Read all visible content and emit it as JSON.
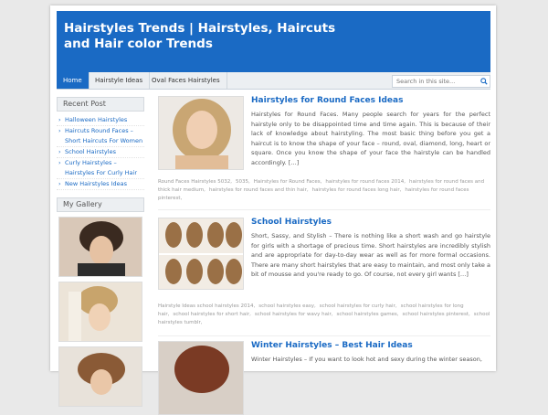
{
  "site": {
    "title": "Hairstyles Trends | Hairstyles, Haircuts and Hair color Trends"
  },
  "nav": {
    "items": [
      "Home",
      "Hairstyle Ideas",
      "Oval Faces Hairstyles"
    ],
    "active": "Home"
  },
  "search": {
    "placeholder": "Search in this site..."
  },
  "sidebar": {
    "recent_title": "Recent Post",
    "recent_posts": [
      "Halloween Hairstyles",
      "Haircuts Round Faces – Short Haircuts For Women",
      "School Hairstyles",
      "Curly Hairstyles – Hairstyles For Curly Hair",
      "New Hairstyles Ideas"
    ],
    "gallery_title": "My Gallery"
  },
  "posts": [
    {
      "title": "Hairstyles for Round Faces Ideas",
      "excerpt": "Hairstyles for Round Faces. Many people search for years for the perfect hairstyle only to be disappointed time and time again. This is because of their lack of knowledge about hairstyling. The most basic thing before you get a haircut is to know the shape of your face – round, oval, diamond, long, heart or square. Once you know the shape of your face the hairstyle can be handled accordingly. […]",
      "tags": [
        "Round Faces Hairstyles 5032,",
        "5035,",
        "Hairstyles for Round Faces,",
        "hairstyles for round faces 2014,",
        "hairstyles for round faces and thick hair medium,",
        "hairstyles for round faces and thin hair,",
        "hairstyles for round faces long hair,",
        "hairstyles for round faces pinterest,"
      ]
    },
    {
      "title": "School Hairstyles",
      "excerpt": "Short, Sassy, and Stylish – There is nothing like a short wash and go hairstyle for girls with a shortage of precious time. Short hairstyles are incredibly stylish and are appropriate for day-to-day wear as well as for more formal occasions. There are many short hairstyles that are easy to maintain, and most only take a bit of mousse and you're ready to go. Of course, not every girl wants […]",
      "tags": [
        "Hairstyle Ideas school hairstyles 2014,",
        "school hairstyles easy,",
        "school hairstyles for curly hair,",
        "school hairstyles for long hair,",
        "school hairstyles for short hair,",
        "school hairstyles for wavy hair,",
        "school hairstyles games,",
        "school hairstyles pinterest,",
        "school hairstyles tumblr,"
      ]
    },
    {
      "title": "Winter Hairstyles – Best Hair Ideas",
      "excerpt": "Winter Hairstyles – If you want to look hot and sexy during the winter season,"
    }
  ],
  "colors": {
    "brand_blue": "#1a6ac4",
    "page_bg": "#e9e9e9"
  }
}
